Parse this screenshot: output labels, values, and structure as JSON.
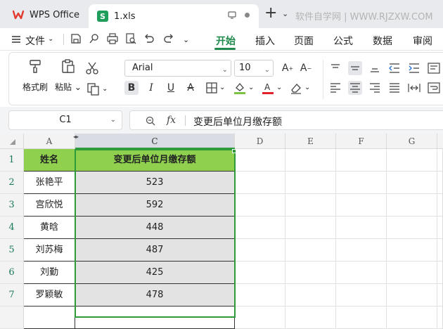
{
  "tabs": {
    "app_tab_label": "WPS Office",
    "file_tab_label": "1.xls",
    "file_icon_letter": "S",
    "new_tab": "+",
    "watermark": "软件自学网 | WWW.RJZXW.COM"
  },
  "menu": {
    "file": "文件",
    "items": [
      "开始",
      "插入",
      "页面",
      "公式",
      "数据",
      "审阅"
    ],
    "active": "开始"
  },
  "ribbon": {
    "format_painter": "格式刷",
    "paste": "粘贴",
    "font_name": "Arial",
    "font_size": "10",
    "bold": "B",
    "italic": "I",
    "underline": "U"
  },
  "formula_bar": {
    "cell_ref": "C1",
    "fx_label": "fx",
    "content": "变更后单位月缴存额"
  },
  "sheet": {
    "visible_columns": [
      "A",
      "C",
      "D",
      "E",
      "F",
      "G"
    ],
    "hidden_marker": "◂▸",
    "row_numbers": [
      "1",
      "2",
      "3",
      "4",
      "5",
      "6",
      "7"
    ],
    "header": [
      "姓名",
      "变更后单位月缴存额"
    ],
    "rows": [
      [
        "张艳平",
        "523"
      ],
      [
        "宫欣悦",
        "592"
      ],
      [
        "黄晗",
        "448"
      ],
      [
        "刘苏梅",
        "487"
      ],
      [
        "刘勤",
        "425"
      ],
      [
        "罗颖敏",
        "478"
      ]
    ]
  },
  "colors": {
    "accent": "#1f8a4c",
    "header_fill": "#8fd14f",
    "selection_border": "#2e9b3a",
    "selected_cells_fill": "#e3e3e3"
  }
}
